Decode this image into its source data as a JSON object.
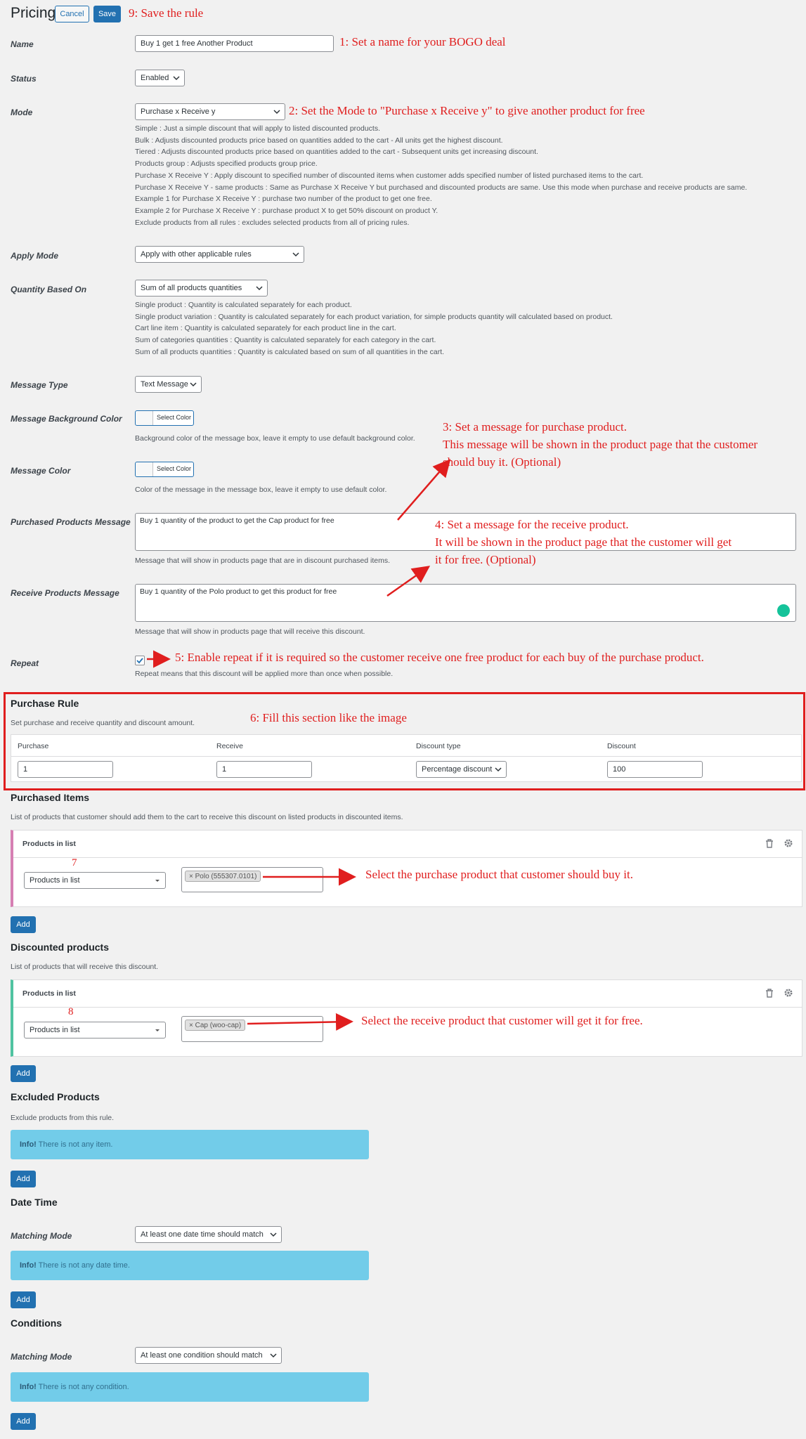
{
  "header": {
    "title": "Pricing",
    "cancel_label": "Cancel",
    "save_label": "Save",
    "note_save": "9: Save the rule"
  },
  "fields": {
    "name_label": "Name",
    "name_value": "Buy 1 get 1 free Another Product",
    "note_name": "1: Set a name for your BOGO deal",
    "status_label": "Status",
    "status_value": "Enabled",
    "mode_label": "Mode",
    "mode_value": "Purchase x Receive y",
    "note_mode": "2: Set the Mode to \"Purchase x Receive y\" to give another product for free",
    "mode_help": [
      "Simple : Just a simple discount that will apply to listed discounted products.",
      "Bulk : Adjusts discounted products price based on quantities added to the cart - All units get the highest discount.",
      "Tiered : Adjusts discounted products price based on quantities added to the cart - Subsequent units get increasing discount.",
      "Products group : Adjusts specified products group price.",
      "Purchase X Receive Y : Apply discount to specified number of discounted items when customer adds specified number of listed purchased items to the cart.",
      "Purchase X Receive Y - same products : Same as Purchase X Receive Y but purchased and discounted products are same. Use this mode when purchase and receive products are same.",
      "Example 1 for Purchase X Receive Y : purchase two number of the product to get one free.",
      "Example 2 for Purchase X Receive Y : purchase product X to get 50% discount on product Y.",
      "Exclude products from all rules : excludes selected products from all of pricing rules."
    ],
    "apply_mode_label": "Apply Mode",
    "apply_mode_value": "Apply with other applicable rules",
    "quantity_label": "Quantity Based On",
    "quantity_value": "Sum of all products quantities",
    "quantity_help": [
      "Single product : Quantity is calculated separately for each product.",
      "Single product variation : Quantity is calculated separately for each product variation, for simple products quantity will calculated based on product.",
      "Cart line item : Quantity is calculated separately for each product line in the cart.",
      "Sum of categories quantities : Quantity is calculated separately for each category in the cart.",
      "Sum of all products quantities : Quantity is calculated based on sum of all quantities in the cart."
    ],
    "message_type_label": "Message Type",
    "message_type_value": "Text Message",
    "msg_bg_label": "Message Background Color",
    "select_color": "Select Color",
    "msg_bg_help": "Background color of the message box, leave it empty to use default background color.",
    "msg_color_label": "Message Color",
    "msg_color_help": "Color of the message in the message box, leave it empty to use default color.",
    "note_purchase_msg": [
      "3: Set a message for purchase product.",
      "This message will be shown in the product page that the customer",
      "should buy it. (Optional)"
    ],
    "purchased_msg_label": "Purchased Products Message",
    "purchased_msg_value": "Buy 1 quantity of the product to get the Cap product for free",
    "purchased_msg_help": "Message that will show in products page that are in discount purchased items.",
    "note_receive_msg": [
      "4: Set a message for the receive product.",
      "It will be shown in the product page that the customer will get",
      "it for free. (Optional)"
    ],
    "receive_msg_label": "Receive Products Message",
    "receive_msg_value": "Buy 1 quantity of the Polo product to get this product for free",
    "receive_msg_help": "Message that will show in products page that will receive this discount.",
    "repeat_label": "Repeat",
    "note_repeat": "5: Enable repeat if it is required so the customer receive one free product for each buy of the purchase product.",
    "repeat_help": "Repeat means that this discount will be applied more than once when possible."
  },
  "purchase_rule": {
    "title": "Purchase Rule",
    "desc": "Set purchase and receive quantity and discount amount.",
    "note": "6: Fill this section like the image",
    "headers": [
      "Purchase",
      "Receive",
      "Discount type",
      "Discount"
    ],
    "purchase_value": "1",
    "receive_value": "1",
    "discount_type_value": "Percentage discount",
    "discount_value": "100"
  },
  "purchased_items": {
    "title": "Purchased Items",
    "desc": "List of products that customer should add them to the cart to receive this discount on listed products in discounted items.",
    "panel_title": "Products in list",
    "select_value": "Products in list",
    "tag": "× Polo (555307.0101)",
    "note_num": "7",
    "note": "Select the purchase product that customer should buy it.",
    "add_label": "Add"
  },
  "discounted_products": {
    "title": "Discounted products",
    "desc": "List of products that will receive this discount.",
    "panel_title": "Products in list",
    "select_value": "Products in list",
    "tag": "× Cap (woo-cap)",
    "note_num": "8",
    "note": "Select the receive product that customer will get it for free.",
    "add_label": "Add"
  },
  "excluded": {
    "title": "Excluded Products",
    "desc": "Exclude products from this rule.",
    "info_strong": "Info!",
    "info_text": " There is not any item.",
    "add_label": "Add"
  },
  "date_time": {
    "title": "Date Time",
    "matching_label": "Matching Mode",
    "matching_value": "At least one date time should match",
    "info_strong": "Info!",
    "info_text": " There is not any date time.",
    "add_label": "Add"
  },
  "conditions": {
    "title": "Conditions",
    "matching_label": "Matching Mode",
    "matching_value": "At least one condition should match",
    "info_strong": "Info!",
    "info_text": " There is not any condition.",
    "add_label": "Add"
  },
  "colors": {
    "annotation": "#e01e1e",
    "primary": "#2271b1",
    "info_bg": "#72cce9",
    "purchased_accent": "#d67fb3",
    "discounted_accent": "#4fc3a1"
  }
}
